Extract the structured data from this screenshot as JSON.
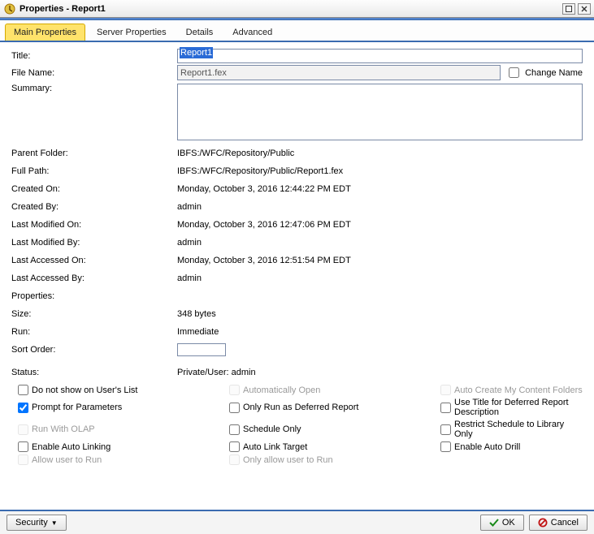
{
  "window": {
    "title": "Properties - Report1"
  },
  "tabs": {
    "main": "Main Properties",
    "server": "Server Properties",
    "details": "Details",
    "advanced": "Advanced"
  },
  "labels": {
    "title": "Title:",
    "filename": "File Name:",
    "summary": "Summary:",
    "parentFolder": "Parent Folder:",
    "fullPath": "Full Path:",
    "createdOn": "Created On:",
    "createdBy": "Created By:",
    "lastModifiedOn": "Last Modified On:",
    "lastModifiedBy": "Last Modified By:",
    "lastAccessedOn": "Last Accessed On:",
    "lastAccessedBy": "Last Accessed By:",
    "properties": "Properties:",
    "size": "Size:",
    "run": "Run:",
    "sortOrder": "Sort Order:",
    "status": "Status:",
    "changeName": "Change Name"
  },
  "values": {
    "title": "Report1",
    "filename": "Report1.fex",
    "summary": "",
    "parentFolder": "IBFS:/WFC/Repository/Public",
    "fullPath": "IBFS:/WFC/Repository/Public/Report1.fex",
    "createdOn": "Monday, October 3, 2016 12:44:22 PM EDT",
    "createdBy": "admin",
    "lastModifiedOn": "Monday, October 3, 2016 12:47:06 PM EDT",
    "lastModifiedBy": "admin",
    "lastAccessedOn": "Monday, October 3, 2016 12:51:54 PM EDT",
    "lastAccessedBy": "admin",
    "properties": "",
    "size": "348 bytes",
    "run": "Immediate",
    "sortOrder": "",
    "status": "Private/User: admin"
  },
  "checks": {
    "doNotShow": "Do not show on User's List",
    "autoOpen": "Automatically Open",
    "autoCreate": "Auto Create My Content Folders",
    "promptParams": "Prompt for Parameters",
    "onlyDeferred": "Only Run as Deferred Report",
    "useTitleDeferred": "Use Title for Deferred Report Description",
    "runOlap": "Run With OLAP",
    "scheduleOnly": "Schedule Only",
    "restrictLibrary": "Restrict Schedule to Library Only",
    "enableAutoLinking": "Enable Auto Linking",
    "autoLinkTarget": "Auto Link Target",
    "enableAutoDrill": "Enable Auto Drill",
    "allowUserRun": "Allow user to Run",
    "onlyAllowUserRun": "Only allow user to Run"
  },
  "buttons": {
    "security": "Security",
    "ok": "OK",
    "cancel": "Cancel"
  }
}
